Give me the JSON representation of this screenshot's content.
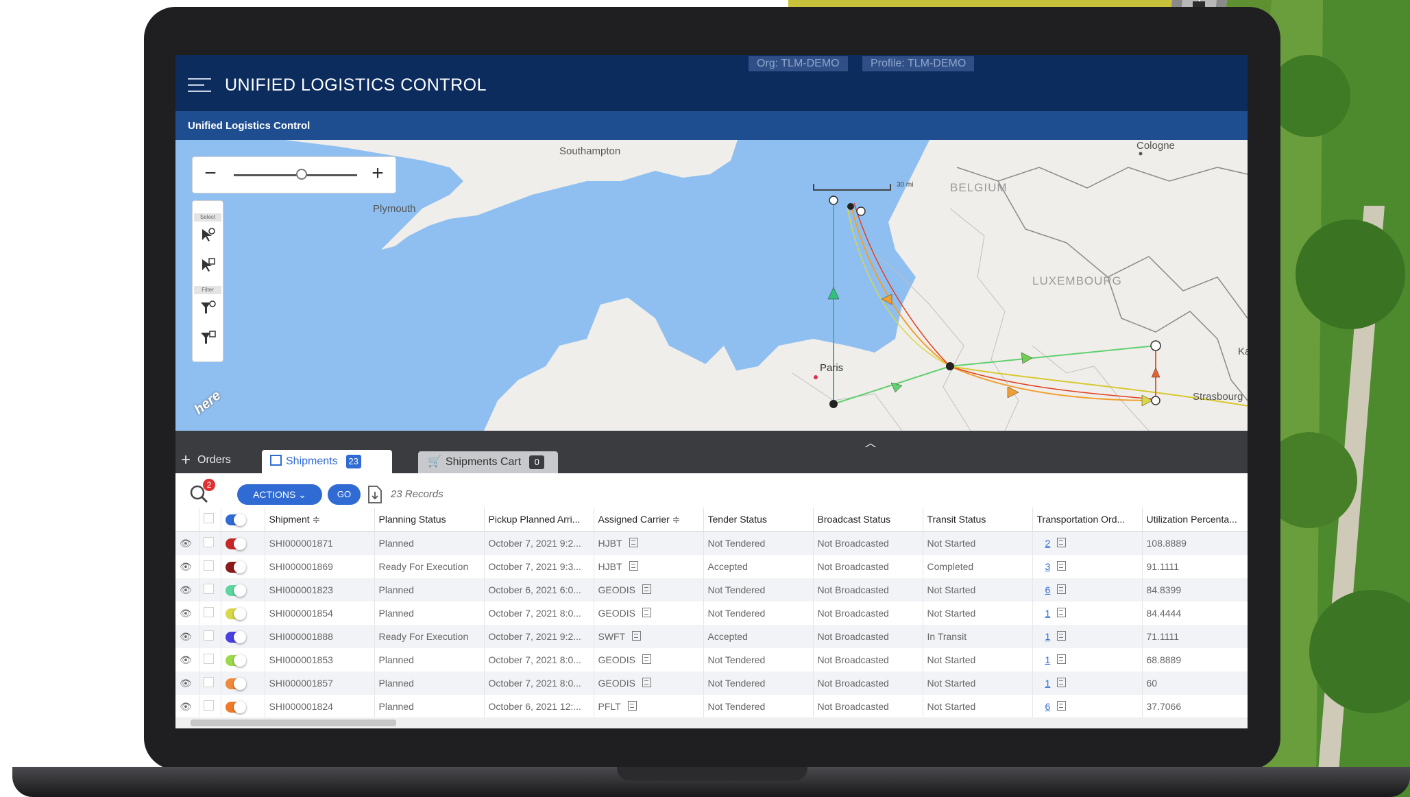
{
  "header": {
    "title": "UNIFIED LOGISTICS CONTROL",
    "org": "Org: TLM-DEMO",
    "profile": "Profile: TLM-DEMO"
  },
  "subheader": {
    "title": "Unified Logistics Control"
  },
  "map": {
    "labels": {
      "southampton": "Southampton",
      "plymouth": "Plymouth",
      "cologne": "Cologne",
      "belgium": "BELGIUM",
      "luxembourg": "LUXEMBOURG",
      "paris": "Paris",
      "strasbourg": "Strasbourg",
      "ka": "Ka"
    },
    "zoom": {
      "minus": "−",
      "plus": "+",
      "level": 0.55
    },
    "tools": {
      "select_label": "Select",
      "filter_label": "Filter"
    },
    "scale": "30 mi",
    "logo": "here"
  },
  "tabs": {
    "orders": "Orders",
    "shipments": "Shipments",
    "shipments_count": "23",
    "cart": "Shipments Cart",
    "cart_count": "0"
  },
  "toolbar": {
    "search_count": "2",
    "actions": "ACTIONS",
    "go": "GO",
    "records": "23 Records"
  },
  "table": {
    "columns": [
      "Shipment ≑",
      "Planning Status",
      "Pickup Planned Arri...",
      "Assigned Carrier ≑",
      "Tender Status",
      "Broadcast Status",
      "Transit Status",
      "Transportation Ord...",
      "Utilization Percenta..."
    ],
    "rows": [
      {
        "color": "#c62828",
        "shipment": "SHI000001871",
        "planning": "Planned",
        "pickup": "October 7, 2021 9:2...",
        "carrier": "HJBT",
        "tender": "Not Tendered",
        "broadcast": "Not Broadcasted",
        "transit": "Not Started",
        "orders": "2",
        "util": "108.8889"
      },
      {
        "color": "#8b1a1a",
        "shipment": "SHI000001869",
        "planning": "Ready For Execution",
        "pickup": "October 7, 2021 9:3...",
        "carrier": "HJBT",
        "tender": "Accepted",
        "broadcast": "Not Broadcasted",
        "transit": "Completed",
        "orders": "3",
        "util": "91.1111"
      },
      {
        "color": "#5ed6a0",
        "shipment": "SHI000001823",
        "planning": "Planned",
        "pickup": "October 6, 2021 6:0...",
        "carrier": "GEODIS",
        "tender": "Not Tendered",
        "broadcast": "Not Broadcasted",
        "transit": "Not Started",
        "orders": "6",
        "util": "84.8399"
      },
      {
        "color": "#d9d84a",
        "shipment": "SHI000001854",
        "planning": "Planned",
        "pickup": "October 7, 2021 8:0...",
        "carrier": "GEODIS",
        "tender": "Not Tendered",
        "broadcast": "Not Broadcasted",
        "transit": "Not Started",
        "orders": "1",
        "util": "84.4444"
      },
      {
        "color": "#4a3fe0",
        "shipment": "SHI000001888",
        "planning": "Ready For Execution",
        "pickup": "October 7, 2021 9:2...",
        "carrier": "SWFT",
        "tender": "Accepted",
        "broadcast": "Not Broadcasted",
        "transit": "In Transit",
        "orders": "1",
        "util": "71.1111"
      },
      {
        "color": "#9bd94a",
        "shipment": "SHI000001853",
        "planning": "Planned",
        "pickup": "October 7, 2021 8:0...",
        "carrier": "GEODIS",
        "tender": "Not Tendered",
        "broadcast": "Not Broadcasted",
        "transit": "Not Started",
        "orders": "1",
        "util": "68.8889"
      },
      {
        "color": "#f08a3a",
        "shipment": "SHI000001857",
        "planning": "Planned",
        "pickup": "October 7, 2021 8:0...",
        "carrier": "GEODIS",
        "tender": "Not Tendered",
        "broadcast": "Not Broadcasted",
        "transit": "Not Started",
        "orders": "1",
        "util": "60"
      },
      {
        "color": "#f07a2a",
        "shipment": "SHI000001824",
        "planning": "Planned",
        "pickup": "October 6, 2021 12:...",
        "carrier": "PFLT",
        "tender": "Not Tendered",
        "broadcast": "Not Broadcasted",
        "transit": "Not Started",
        "orders": "6",
        "util": "37.7066"
      }
    ]
  },
  "colors": {
    "header": "#0d2c5e",
    "subheader": "#1e4e90",
    "accent": "#2f6bd3",
    "water": "#8fbff0",
    "land": "#f0eeea",
    "tabbar": "#3a3c40"
  }
}
